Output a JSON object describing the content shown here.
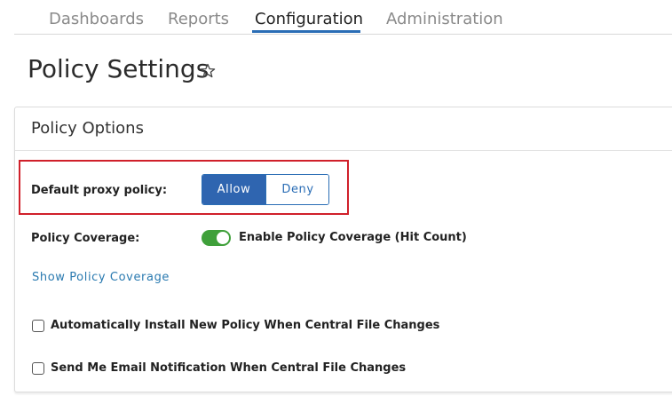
{
  "nav": {
    "tabs": [
      {
        "label": "Dashboards"
      },
      {
        "label": "Reports"
      },
      {
        "label": "Configuration"
      },
      {
        "label": "Administration"
      }
    ],
    "active_tab": "Configuration"
  },
  "page": {
    "title": "Policy Settings",
    "favorite_icon": "star-outline-icon"
  },
  "panel": {
    "title": "Policy Options",
    "proxy_policy": {
      "label": "Default proxy policy:",
      "options": [
        "Allow",
        "Deny"
      ],
      "selected": "Allow"
    },
    "coverage": {
      "label": "Policy Coverage:",
      "toggle_label": "Enable Policy Coverage (Hit Count)",
      "enabled": true,
      "link": "Show Policy Coverage"
    },
    "checkboxes": [
      {
        "label": "Automatically Install New Policy When Central File Changes",
        "checked": false
      },
      {
        "label": "Send Me Email Notification When Central File Changes",
        "checked": false
      }
    ]
  },
  "colors": {
    "accent": "#2f65b0",
    "toggle_on": "#3fa03a",
    "highlight": "#d0202a",
    "link": "#2a7ab0"
  }
}
